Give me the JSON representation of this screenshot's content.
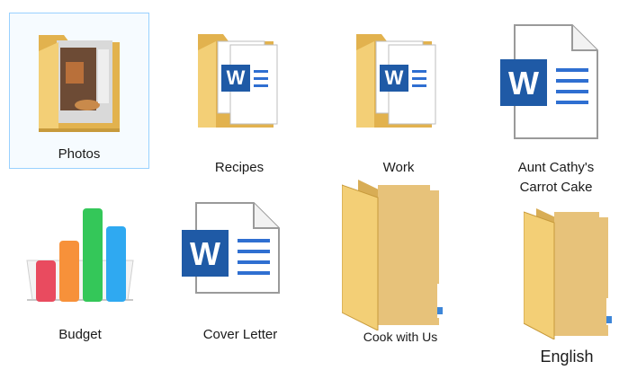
{
  "desktop": {
    "items": [
      {
        "label": "Photos",
        "icon": "folder-photos-icon",
        "selected": true
      },
      {
        "label": "Recipes",
        "icon": "folder-documents-icon"
      },
      {
        "label": "Work",
        "icon": "folder-documents-icon"
      },
      {
        "label": "Aunt Cathy's",
        "label2": "Carrot Cake",
        "icon": "word-document-icon"
      },
      {
        "label": "Budget",
        "icon": "numbers-spreadsheet-icon"
      },
      {
        "label": "Cover Letter",
        "icon": "word-document-icon"
      },
      {
        "label": "Cook with Us",
        "icon": "folder-icon"
      },
      {
        "label": "English",
        "icon": "folder-icon"
      }
    ]
  },
  "colors": {
    "selection_border": "#99d1ff",
    "folder": "#f3cf76",
    "word_blue": "#1f5aa6"
  }
}
